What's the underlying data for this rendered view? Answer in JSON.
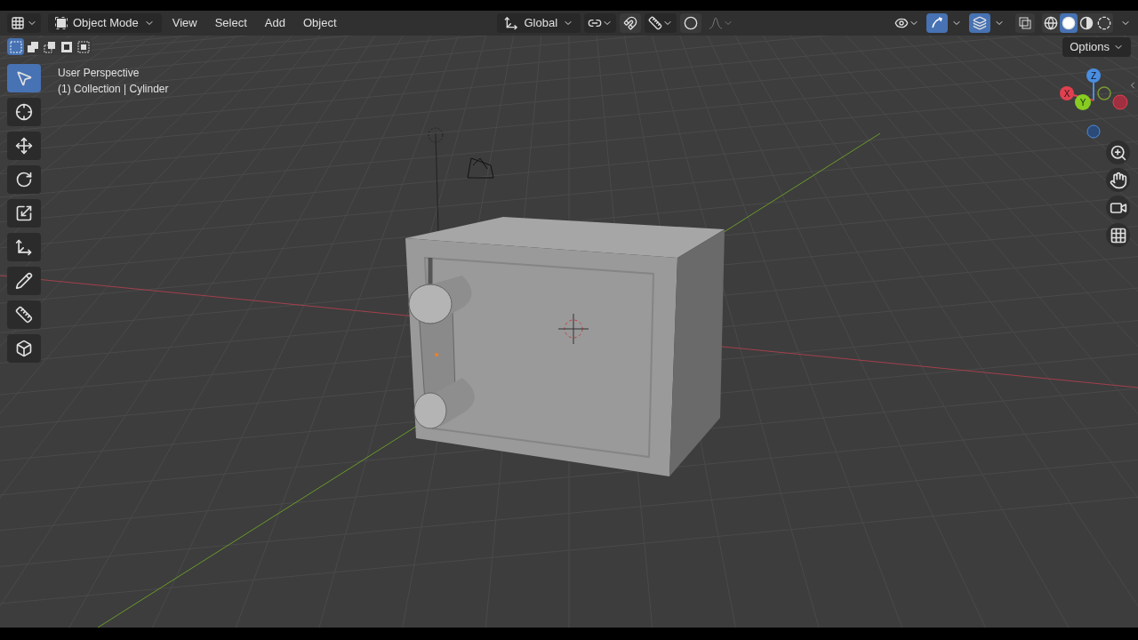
{
  "header": {
    "mode": "Object Mode",
    "menus": [
      "View",
      "Select",
      "Add",
      "Object"
    ],
    "orientation": "Global",
    "snap_on": false,
    "proportional_on": false,
    "gizmos_on": true,
    "overlays_on": true
  },
  "select_modes": [
    {
      "kind": "set",
      "selected": true
    },
    {
      "kind": "extend",
      "selected": false
    },
    {
      "kind": "subtract",
      "selected": false
    },
    {
      "kind": "difference",
      "selected": false
    },
    {
      "kind": "intersect",
      "selected": false
    }
  ],
  "shading_modes": [
    {
      "kind": "wireframe",
      "selected": false
    },
    {
      "kind": "solid",
      "selected": true
    },
    {
      "kind": "material",
      "selected": false
    },
    {
      "kind": "rendered",
      "selected": false
    }
  ],
  "options_button": "Options",
  "viewport": {
    "view_name": "User Perspective",
    "context": "(1) Collection | Cylinder"
  },
  "tools": [
    {
      "kind": "select",
      "selected": true
    },
    {
      "kind": "cursor",
      "selected": false
    },
    {
      "kind": "move",
      "selected": false
    },
    {
      "kind": "rotate",
      "selected": false
    },
    {
      "kind": "scale",
      "selected": false
    },
    {
      "kind": "transform",
      "selected": false
    },
    {
      "kind": "annotate",
      "selected": false
    },
    {
      "kind": "measure",
      "selected": false
    },
    {
      "kind": "add-cube",
      "selected": false
    }
  ],
  "axis_gizmo": {
    "z": "Z",
    "x": "X",
    "y": "Y"
  },
  "nav_buttons": [
    {
      "kind": "zoom"
    },
    {
      "kind": "pan"
    },
    {
      "kind": "camera"
    },
    {
      "kind": "perspective"
    }
  ]
}
